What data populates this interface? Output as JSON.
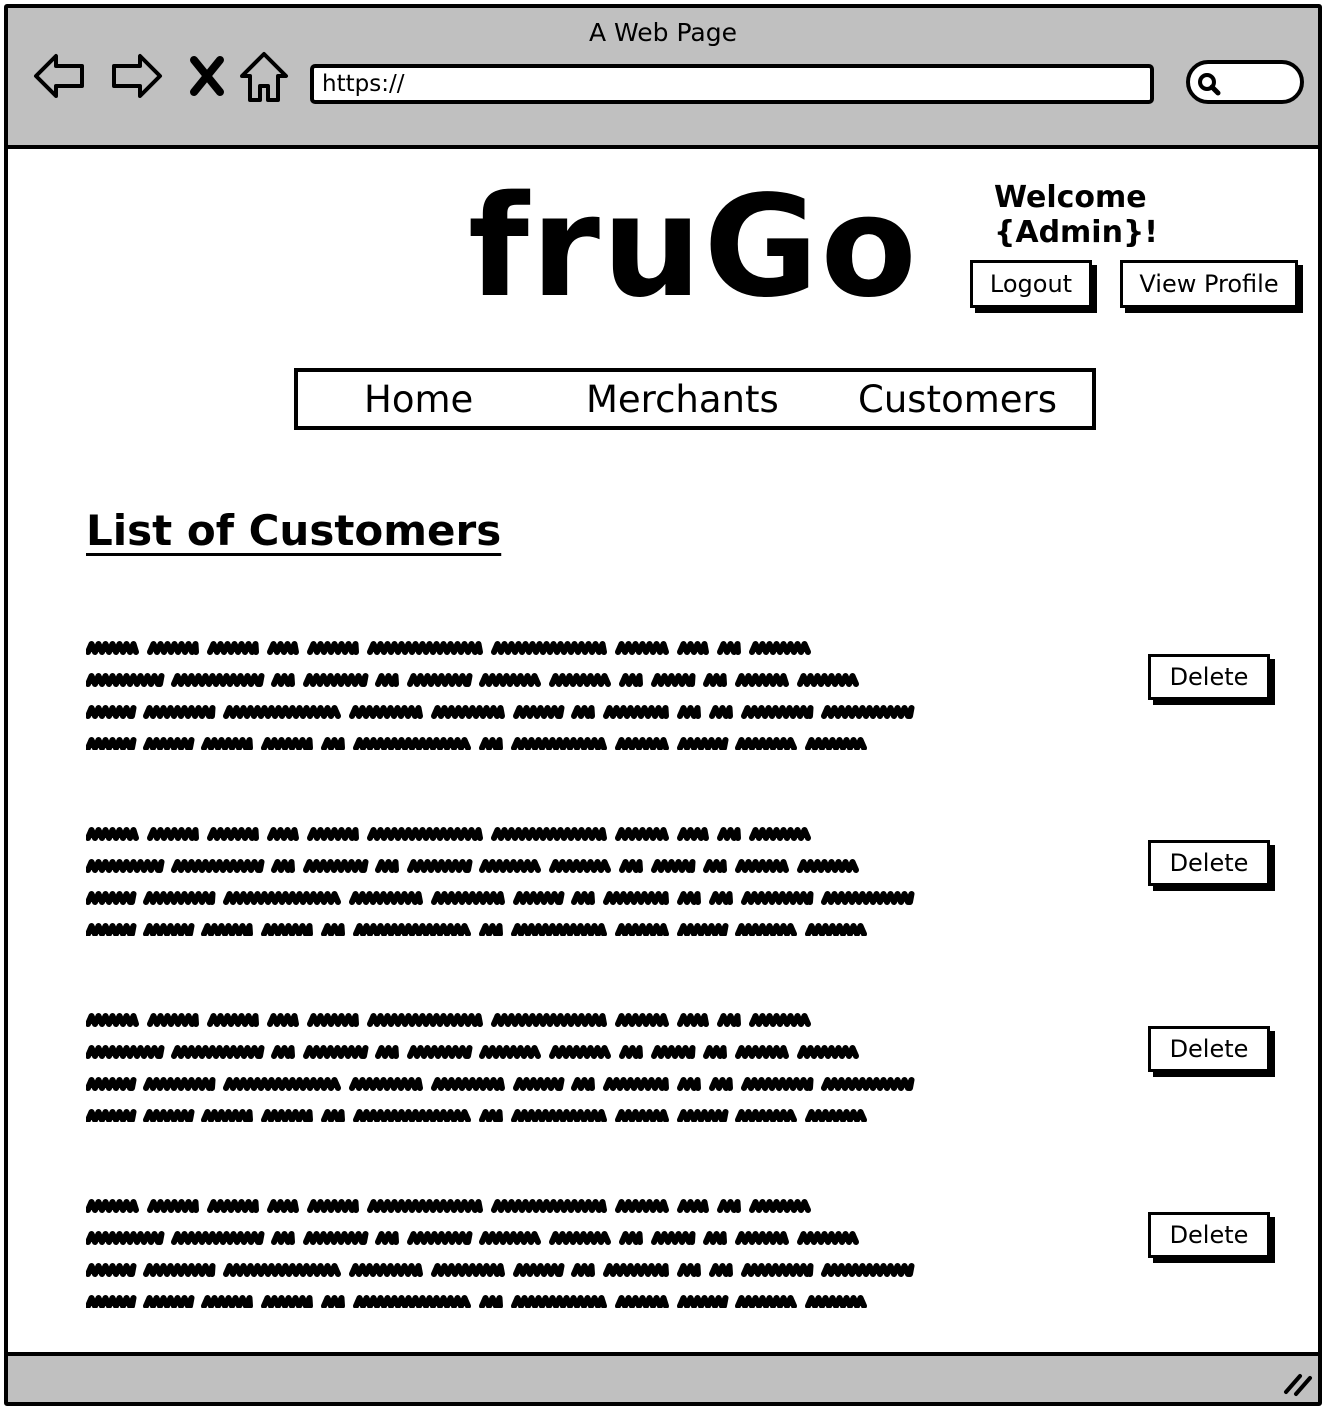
{
  "browser": {
    "title": "A Web Page",
    "url": "https://",
    "nav_icons": [
      "back-arrow-icon",
      "forward-arrow-icon",
      "close-icon",
      "home-icon"
    ]
  },
  "header": {
    "logo": "fruGo",
    "welcome": "Welcome {Admin}!",
    "logout_label": "Logout",
    "profile_label": "View Profile"
  },
  "nav": {
    "items": [
      {
        "label": "Home"
      },
      {
        "label": "Merchants"
      },
      {
        "label": "Customers"
      }
    ]
  },
  "main": {
    "heading": "List of Customers",
    "customers": [
      {
        "delete_label": "Delete"
      },
      {
        "delete_label": "Delete"
      },
      {
        "delete_label": "Delete"
      },
      {
        "delete_label": "Delete"
      }
    ]
  }
}
